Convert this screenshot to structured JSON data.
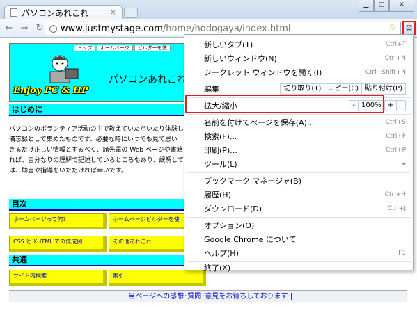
{
  "browser": {
    "tab_title": "パソコンあれこれ",
    "tab_close": "×",
    "url_host": "www.justmystage.com",
    "url_path": "/home/hodogaya/index.html",
    "star": "☆",
    "wrench": "🔧"
  },
  "page": {
    "top_nav": [
      "トップ",
      "ホームページ",
      "ビルダーを使"
    ],
    "brand": "Enjoy PC & HP",
    "site_title": "パソコンあれこれ",
    "intro_heading": "はじめに",
    "intro_lines": [
      "パソコンのボランティア活動の中で教えていただいたり体験し",
      "備忘録として集めたものです。必要な時にいつでも見て思い",
      "きるだけ正しい情報とするべく、諸先輩の Web ページや書籍",
      "れば、自分なりの理解で記述しているところもあり、誤解してい",
      "は、助言や指導をいただければ幸いです。"
    ],
    "toc_heading": "目次",
    "toc_items": [
      "ホームページって何？",
      "ホームページビルダーを使",
      "CSS と XHTML での作成例",
      "その他あれこれ"
    ],
    "common_heading": "共通",
    "common_items": [
      "サイト内検索",
      "索引"
    ],
    "footer": "| 当ページへの感想･質問･意見をお待ちしております |"
  },
  "menu": {
    "new_tab": {
      "label": "新しいタブ(T)",
      "shortcut": "Ctrl+T"
    },
    "new_window": {
      "label": "新しいウィンドウ(N)",
      "shortcut": "Ctrl+N"
    },
    "incognito": {
      "label": "シークレット ウィンドウを開く(I)",
      "shortcut": "Ctrl+Shift+N"
    },
    "edit": {
      "label": "編集",
      "cut": "切り取り(T)",
      "copy": "コピー(C)",
      "paste": "貼り付け(P)"
    },
    "zoom": {
      "label": "拡大/縮小",
      "minus": "-",
      "value": "100%",
      "plus": "+"
    },
    "save_page": {
      "label": "名前を付けてページを保存(A)...",
      "shortcut": "Ctrl+S"
    },
    "find": {
      "label": "検索(F)...",
      "shortcut": "Ctrl+F"
    },
    "print": {
      "label": "印刷(P)...",
      "shortcut": "Ctrl+P"
    },
    "tools": {
      "label": "ツール(L)",
      "arrow": "▸"
    },
    "bookmark_manager": {
      "label": "ブックマーク マネージャ(B)"
    },
    "history": {
      "label": "履歴(H)",
      "shortcut": "Ctrl+H"
    },
    "downloads": {
      "label": "ダウンロード(D)",
      "shortcut": "Ctrl+J"
    },
    "options": {
      "label": "オプション(O)"
    },
    "about": {
      "label": "Google Chrome について"
    },
    "help": {
      "label": "ヘルプ(H)",
      "shortcut": "F1"
    },
    "exit": {
      "label": "終了(X)"
    }
  }
}
